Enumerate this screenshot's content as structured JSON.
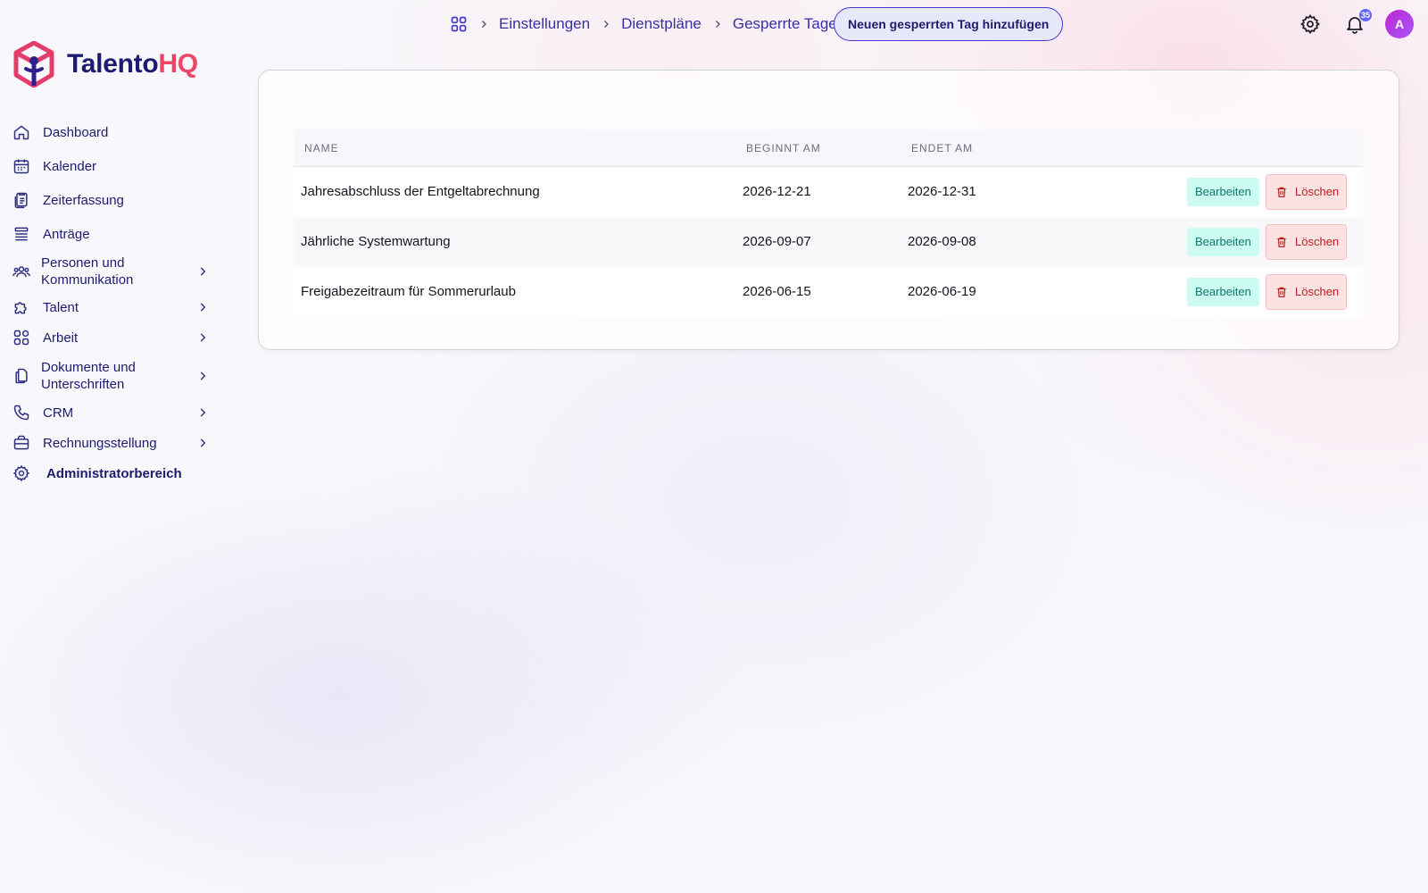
{
  "brand": {
    "name_part1": "Talento",
    "name_part2": "HQ",
    "primary": "#1e1b6e",
    "accent": "#ec4566"
  },
  "sidebar": {
    "items": [
      {
        "label": "Dashboard",
        "icon": "home-icon"
      },
      {
        "label": "Kalender",
        "icon": "calendar-icon"
      },
      {
        "label": "Zeiterfassung",
        "icon": "clipboard-clock-icon"
      },
      {
        "label": "Anträge",
        "icon": "list-stack-icon"
      },
      {
        "label": "Personen und Kommunikation",
        "icon": "users-icon",
        "expandable": true
      },
      {
        "label": "Talent",
        "icon": "puzzle-icon",
        "expandable": true
      },
      {
        "label": "Arbeit",
        "icon": "apps-icon",
        "expandable": true
      },
      {
        "label": "Dokumente und Unterschriften",
        "icon": "documents-icon",
        "expandable": true
      },
      {
        "label": "CRM",
        "icon": "phone-icon",
        "expandable": true
      },
      {
        "label": "Rechnungsstellung",
        "icon": "briefcase-icon",
        "expandable": true
      },
      {
        "label": "Administratorbereich",
        "icon": "gear-icon"
      }
    ]
  },
  "header": {
    "breadcrumb": [
      "Einstellungen",
      "Dienstpläne",
      "Gesperrte Tage"
    ],
    "add_button": "Neuen gesperrten Tag hinzufügen",
    "notification_count": "35",
    "avatar_initial": "A"
  },
  "table": {
    "columns": [
      "NAME",
      "BEGINNT AM",
      "ENDET AM"
    ],
    "edit_label": "Bearbeiten",
    "delete_label": "Löschen",
    "rows": [
      {
        "name": "Jahresabschluss der Entgeltabrechnung",
        "start": "2026-12-21",
        "end": "2026-12-31"
      },
      {
        "name": "Jährliche Systemwartung",
        "start": "2026-09-07",
        "end": "2026-09-08"
      },
      {
        "name": "Freigabezeitraum für Sommerurlaub",
        "start": "2026-06-15",
        "end": "2026-06-19"
      }
    ]
  }
}
